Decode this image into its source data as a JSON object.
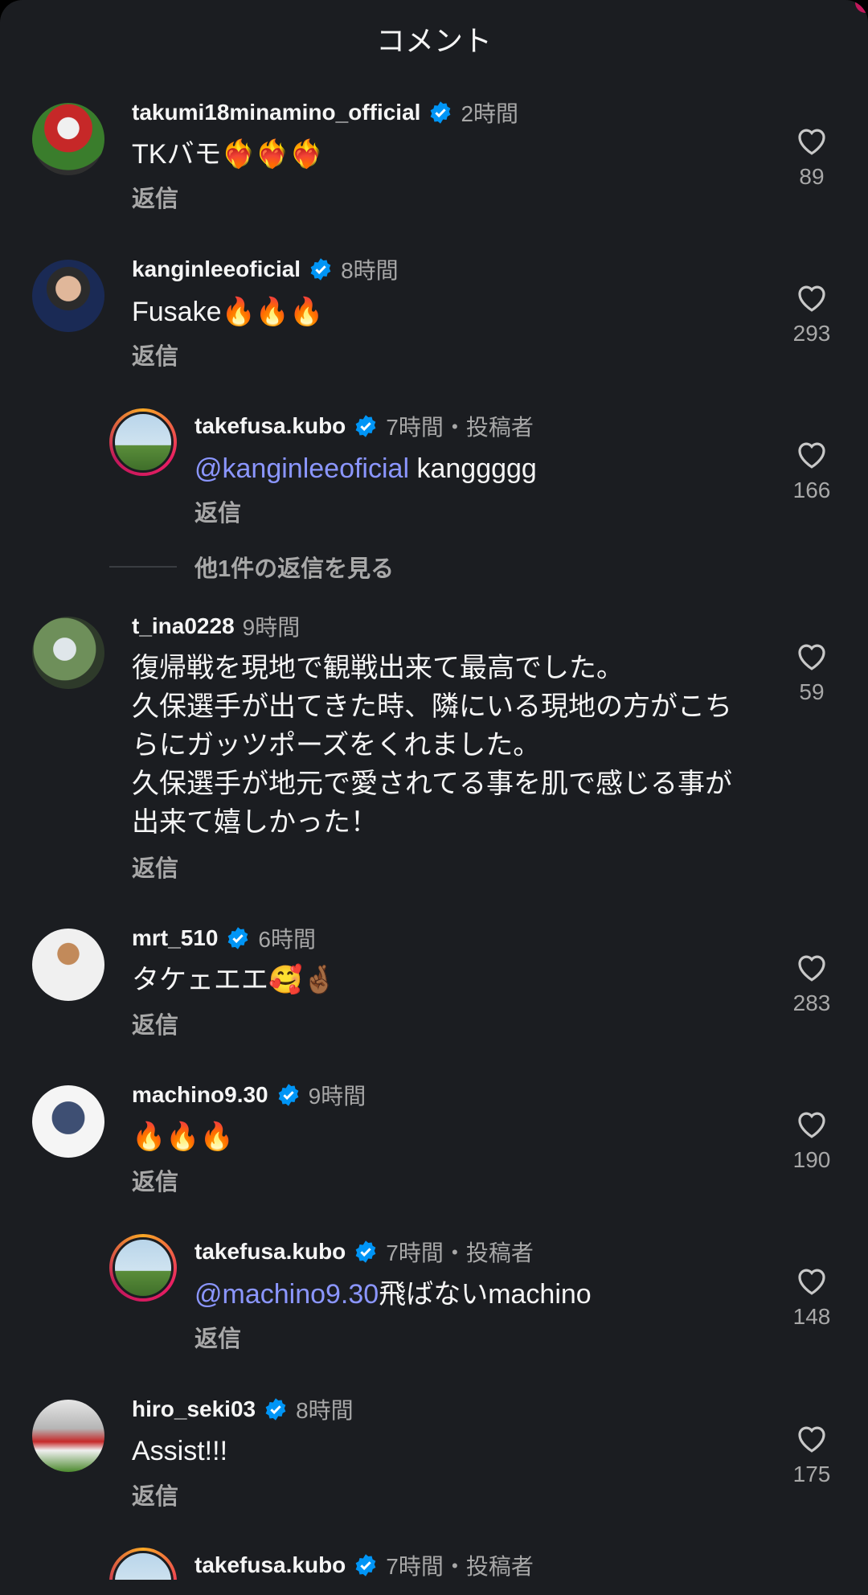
{
  "header": {
    "title": "コメント"
  },
  "reply_label": "返信",
  "more_replies_label": "他1件の返信を見る",
  "comments": [
    {
      "username": "takumi18minamino_official",
      "verified": true,
      "time": "2時間",
      "text": "TKバモ❤️‍🔥❤️‍🔥❤️‍🔥",
      "likes": "89"
    },
    {
      "username": "kanginleeoficial",
      "verified": true,
      "time": "8時間",
      "text": "Fusake🔥🔥🔥",
      "likes": "293"
    },
    {
      "username": "takefusa.kubo",
      "verified": true,
      "time": "7時間・投稿者",
      "mention": "@kanginleeoficial",
      "text": " kanggggg",
      "likes": "166"
    },
    {
      "username": "t_ina0228",
      "verified": false,
      "time": "9時間",
      "text_lines": [
        "復帰戦を現地で観戦出来て最高でした。",
        "久保選手が出てきた時、隣にいる現地の方がこち",
        "らにガッツポーズをくれました。",
        "久保選手が地元で愛されてる事を肌で感じる事が",
        "出来て嬉しかった！"
      ],
      "likes": "59"
    },
    {
      "username": "mrt_510",
      "verified": true,
      "time": "6時間",
      "text": "タケェエエ🥰🤞🏾",
      "likes": "283"
    },
    {
      "username": "machino9.30",
      "verified": true,
      "time": "9時間",
      "text": "🔥🔥🔥",
      "likes": "190"
    },
    {
      "username": "takefusa.kubo",
      "verified": true,
      "time": "7時間・投稿者",
      "mention": "@machino9.30",
      "text": "飛ばないmachino",
      "likes": "148"
    },
    {
      "username": "hiro_seki03",
      "verified": true,
      "time": "8時間",
      "text": "Assist!!!",
      "likes": "175"
    },
    {
      "username": "takefusa.kubo",
      "verified": true,
      "time": "7時間・投稿者"
    }
  ],
  "colors": {
    "background": "#1b1d21",
    "mention": "#8b96ff",
    "verified": "#0095f6",
    "muted": "#a8a8a8"
  }
}
